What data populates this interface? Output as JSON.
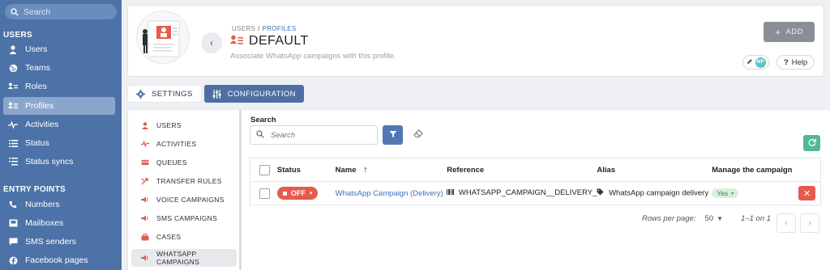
{
  "sidebar": {
    "search_placeholder": "Search",
    "section_users": "USERS",
    "users_items": [
      {
        "label": "Users",
        "icon": "person-icon"
      },
      {
        "label": "Teams",
        "icon": "globe-icon"
      },
      {
        "label": "Roles",
        "icon": "roles-icon"
      },
      {
        "label": "Profiles",
        "icon": "profile-card-icon"
      },
      {
        "label": "Activities",
        "icon": "activity-pulse-icon"
      },
      {
        "label": "Status",
        "icon": "list-icon"
      },
      {
        "label": "Status syncs",
        "icon": "sync-list-icon"
      }
    ],
    "section_entry": "ENTRY POINTS",
    "entry_items": [
      {
        "label": "Numbers",
        "icon": "phone-icon"
      },
      {
        "label": "Mailboxes",
        "icon": "mailbox-icon"
      },
      {
        "label": "SMS senders",
        "icon": "sms-icon"
      },
      {
        "label": "Facebook pages",
        "icon": "facebook-icon"
      }
    ]
  },
  "header": {
    "breadcrumb_root": "USERS",
    "breadcrumb_sep": "/",
    "breadcrumb_current": "PROFILES",
    "title": "DEFAULT",
    "subtitle": "Associate WhatsApp campaigns with this profile.",
    "add_label": "ADD",
    "mp_badge": "MP",
    "help_label": "Help"
  },
  "tabs": {
    "settings": "SETTINGS",
    "configuration": "CONFIGURATION"
  },
  "subnav": [
    {
      "label": "USERS",
      "icon": "person-icon"
    },
    {
      "label": "ACTIVITIES",
      "icon": "activity-pulse-icon"
    },
    {
      "label": "QUEUES",
      "icon": "queues-icon"
    },
    {
      "label": "TRANSFER RULES",
      "icon": "transfer-icon"
    },
    {
      "label": "VOICE CAMPAIGNS",
      "icon": "voice-campaign-icon"
    },
    {
      "label": "SMS CAMPAIGNS",
      "icon": "sms-campaign-icon"
    },
    {
      "label": "CASES",
      "icon": "briefcase-icon"
    },
    {
      "label": "WHATSAPP CAMPAIGNS",
      "icon": "whatsapp-campaign-icon"
    }
  ],
  "search": {
    "label": "Search",
    "placeholder": "Search"
  },
  "table": {
    "headers": {
      "status": "Status",
      "name": "Name",
      "reference": "Reference",
      "alias": "Alias",
      "manage": "Manage the campaign"
    },
    "rows": [
      {
        "status": "OFF",
        "name": "WhatsApp Campaign (Delivery)",
        "reference": "WHATSAPP_CAMPAIGN__DELIVERY_",
        "alias": "WhatsApp campaign delivery",
        "manage": "Yes"
      }
    ]
  },
  "pagination": {
    "rows_per_page_label": "Rows per page:",
    "rows_per_page_value": "50",
    "range": "1–1 on 1"
  },
  "colors": {
    "sidebar_bg": "#4c72a8",
    "accent_blue": "#4e6fa3",
    "danger_red": "#e55b4d",
    "success_green": "#52b990"
  }
}
